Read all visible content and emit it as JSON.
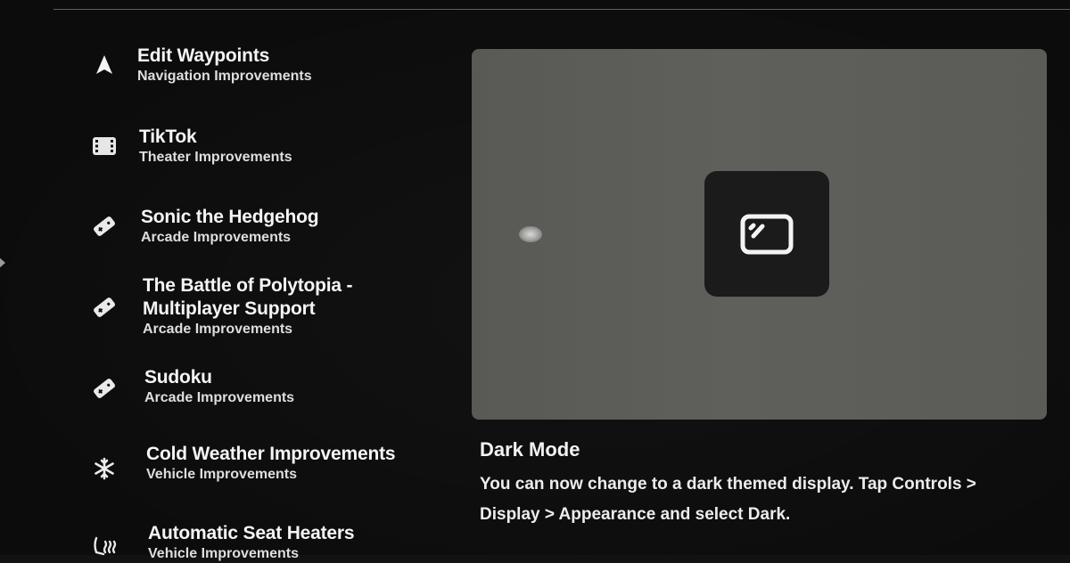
{
  "release_notes": {
    "items": [
      {
        "icon": "navigation-arrow-icon",
        "title": "Edit Waypoints",
        "subtitle": "Navigation Improvements"
      },
      {
        "icon": "theater-film-icon",
        "title": "TikTok",
        "subtitle": "Theater Improvements"
      },
      {
        "icon": "arcade-controller-icon",
        "title": "Sonic the Hedgehog",
        "subtitle": "Arcade Improvements"
      },
      {
        "icon": "arcade-controller-icon",
        "title": "The Battle of Polytopia -",
        "title_line2": "Multiplayer Support",
        "subtitle": "Arcade Improvements"
      },
      {
        "icon": "arcade-controller-icon",
        "title": "Sudoku",
        "subtitle": "Arcade Improvements"
      },
      {
        "icon": "snowflake-icon",
        "title": "Cold Weather Improvements",
        "subtitle": "Vehicle Improvements"
      },
      {
        "icon": "seat-heater-icon",
        "title": "Automatic Seat Heaters",
        "subtitle": "Vehicle Improvements"
      }
    ]
  },
  "detail": {
    "preview_icon": "display-appearance-icon",
    "title": "Dark Mode",
    "description": "You can now change to a dark themed display. Tap Controls > Display > Appearance and select Dark."
  },
  "colors": {
    "background": "#121212",
    "preview_panel": "#5c5c58",
    "app_tile": "#1b1b1b",
    "text": "#f2f2f2"
  }
}
